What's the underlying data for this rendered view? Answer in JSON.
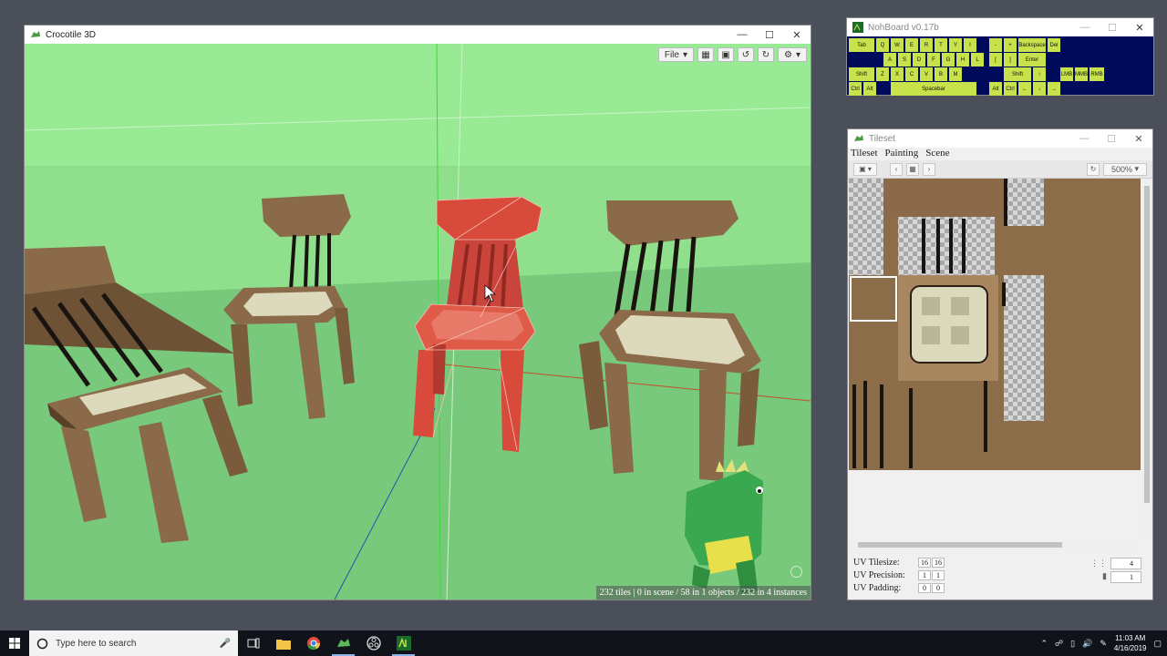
{
  "main_window": {
    "title": "Crocotile 3D",
    "file_menu": "File",
    "status": "232 tiles | 0 in scene / 58 in 1 objects / 232 in 4 instances"
  },
  "nohboard": {
    "title": "NohBoard v0.17b",
    "keys": [
      {
        "label": "Tab"
      },
      {
        "label": "Q"
      },
      {
        "label": "W"
      },
      {
        "label": "E"
      },
      {
        "label": "R"
      },
      {
        "label": "T"
      },
      {
        "label": "Y"
      },
      {
        "label": "I"
      },
      {
        "label": "-"
      },
      {
        "label": "+"
      },
      {
        "label": "Backspace"
      },
      {
        "label": "Del"
      },
      {
        "label": "A"
      },
      {
        "label": "S"
      },
      {
        "label": "D"
      },
      {
        "label": "F"
      },
      {
        "label": "G"
      },
      {
        "label": "H"
      },
      {
        "label": "L"
      },
      {
        "label": "["
      },
      {
        "label": "]"
      },
      {
        "label": "Enter"
      },
      {
        "label": "Shift"
      },
      {
        "label": "Z"
      },
      {
        "label": "X"
      },
      {
        "label": "C"
      },
      {
        "label": "V"
      },
      {
        "label": "B"
      },
      {
        "label": "M"
      },
      {
        "label": "Shift"
      },
      {
        "label": "↑"
      },
      {
        "label": "LMB"
      },
      {
        "label": "MMB"
      },
      {
        "label": "RMB"
      },
      {
        "label": "Ctrl"
      },
      {
        "label": "Alt"
      },
      {
        "label": "Spacebar"
      },
      {
        "label": "Alt"
      },
      {
        "label": "Ctrl"
      },
      {
        "label": "←"
      },
      {
        "label": "↓"
      },
      {
        "label": "→"
      }
    ]
  },
  "tileset_window": {
    "title": "Tileset",
    "menu": [
      "Tileset",
      "Painting",
      "Scene"
    ],
    "zoom": "500%",
    "uv": {
      "tilesize_label": "UV Tilesize:",
      "tilesize": [
        "16",
        "16"
      ],
      "precision_label": "UV Precision:",
      "precision": [
        "1",
        "1"
      ],
      "padding_label": "UV Padding:",
      "padding": [
        "0",
        "0"
      ],
      "spin_a": "4",
      "spin_b": "1"
    }
  },
  "taskbar": {
    "search_placeholder": "Type here to search",
    "time": "11:03 AM",
    "date": "4/16/2019"
  },
  "colors": {
    "viewport_green": "#79c97c",
    "sky_green": "#98ea94",
    "chair_brown": "#8a6a48",
    "selected_red": "#d84a3a",
    "tile_brown": "#8c6d4a",
    "nohboard_key": "#c7e24a",
    "nohboard_bg": "#000a5a"
  }
}
